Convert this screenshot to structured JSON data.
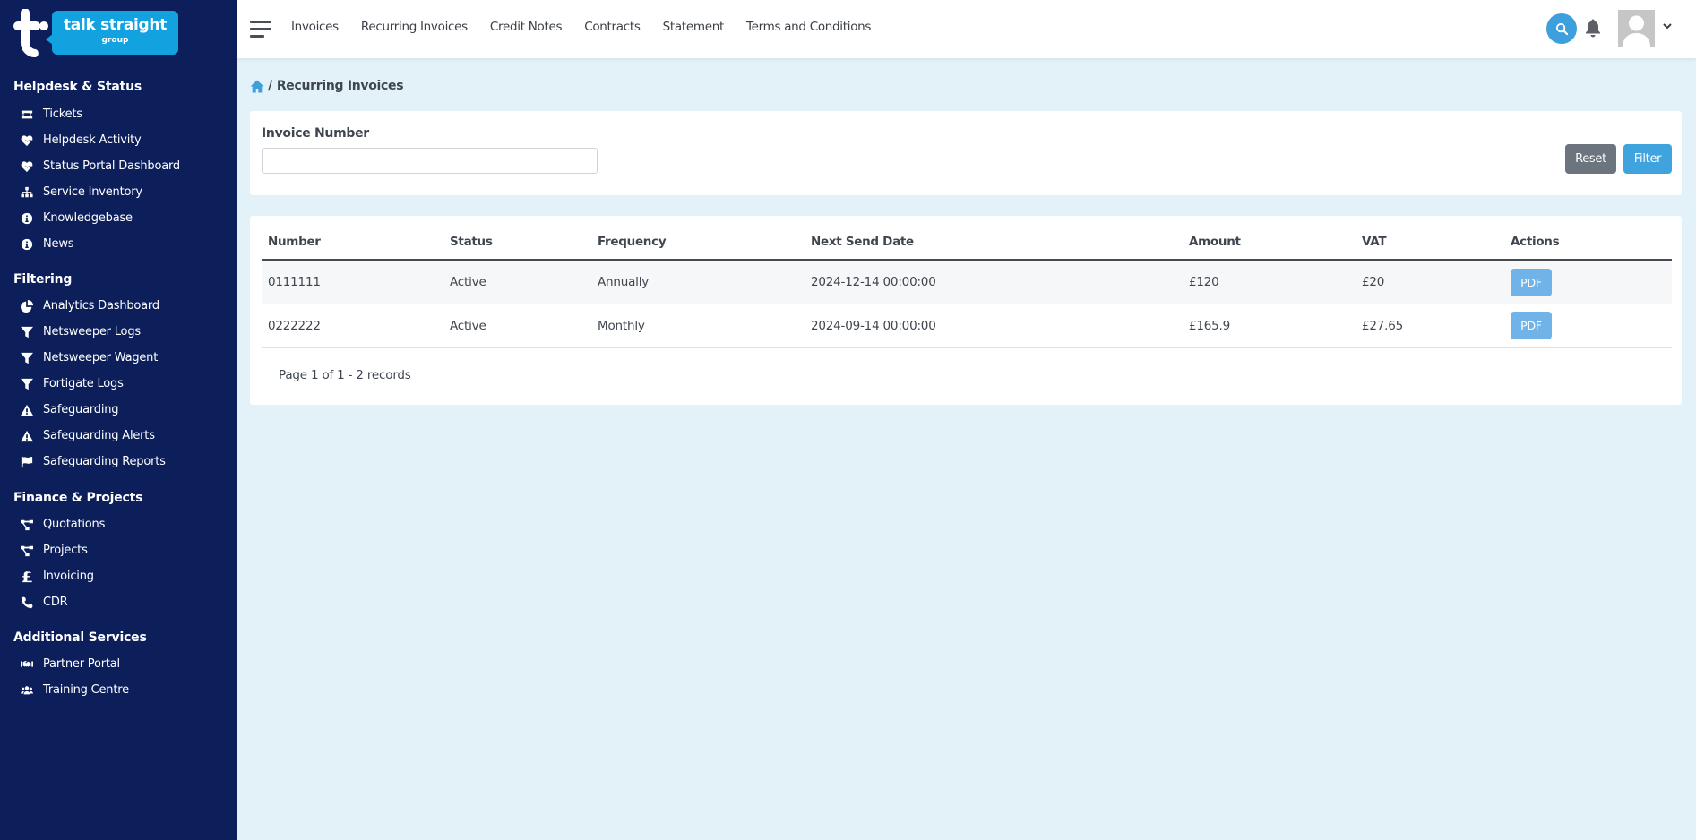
{
  "brand": {
    "name": "talk straight",
    "sub": "group",
    "sidebar_color": "#0c1f5b",
    "accent_color": "#3fa3dd"
  },
  "sidebar": {
    "sections": [
      {
        "title": "Helpdesk & Status",
        "items": [
          {
            "label": "Tickets",
            "icon": "ticket-icon"
          },
          {
            "label": "Helpdesk Activity",
            "icon": "heartbeat-icon"
          },
          {
            "label": "Status Portal Dashboard",
            "icon": "heartbeat-icon"
          },
          {
            "label": "Service Inventory",
            "icon": "network-icon"
          },
          {
            "label": "Knowledgebase",
            "icon": "info-circle-icon"
          },
          {
            "label": "News",
            "icon": "info-circle-icon"
          }
        ]
      },
      {
        "title": "Filtering",
        "items": [
          {
            "label": "Analytics Dashboard",
            "icon": "pie-chart-icon"
          },
          {
            "label": "Netsweeper Logs",
            "icon": "filter-icon"
          },
          {
            "label": "Netsweeper Wagent",
            "icon": "filter-icon"
          },
          {
            "label": "Fortigate Logs",
            "icon": "filter-icon"
          },
          {
            "label": "Safeguarding",
            "icon": "warning-icon"
          },
          {
            "label": "Safeguarding Alerts",
            "icon": "warning-icon"
          },
          {
            "label": "Safeguarding Reports",
            "icon": "flag-icon"
          }
        ]
      },
      {
        "title": "Finance & Projects",
        "items": [
          {
            "label": "Quotations",
            "icon": "project-diagram-icon"
          },
          {
            "label": "Projects",
            "icon": "project-diagram-icon"
          },
          {
            "label": "Invoicing",
            "icon": "pound-icon"
          },
          {
            "label": "CDR",
            "icon": "phone-icon"
          }
        ]
      },
      {
        "title": "Additional Services",
        "items": [
          {
            "label": "Partner Portal",
            "icon": "handshake-icon"
          },
          {
            "label": "Training Centre",
            "icon": "users-icon"
          }
        ]
      }
    ]
  },
  "header": {
    "nav": [
      {
        "label": "Invoices"
      },
      {
        "label": "Recurring Invoices"
      },
      {
        "label": "Credit Notes"
      },
      {
        "label": "Contracts"
      },
      {
        "label": "Statement"
      },
      {
        "label": "Terms and Conditions"
      }
    ]
  },
  "breadcrumb": {
    "separator": "/",
    "current": "Recurring Invoices"
  },
  "filter": {
    "label": "Invoice Number",
    "value": "",
    "placeholder": "",
    "reset_label": "Reset",
    "filter_label": "Filter"
  },
  "table": {
    "columns": [
      "Number",
      "Status",
      "Frequency",
      "Next Send Date",
      "Amount",
      "VAT",
      "Actions"
    ],
    "rows": [
      {
        "number": "0111111",
        "status": "Active",
        "frequency": "Annually",
        "next_send_date": "2024-12-14 00:00:00",
        "amount": "£120",
        "vat": "£20",
        "action": "PDF"
      },
      {
        "number": "0222222",
        "status": "Active",
        "frequency": "Monthly",
        "next_send_date": "2024-09-14 00:00:00",
        "amount": "£165.9",
        "vat": "£27.65",
        "action": "PDF"
      }
    ],
    "pagination": "Page 1 of 1 - 2 records"
  }
}
